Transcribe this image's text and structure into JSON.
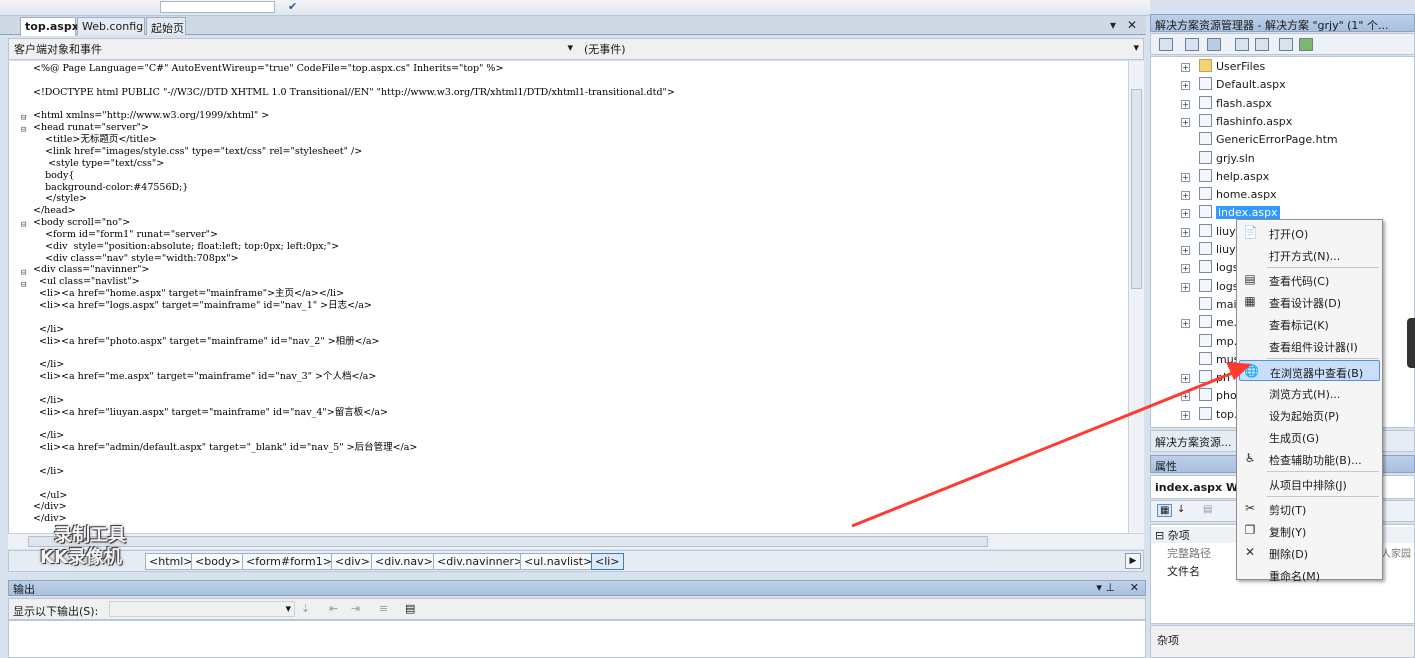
{
  "tabs": [
    {
      "label": "top.aspx",
      "active": true
    },
    {
      "label": "Web.config",
      "active": false
    },
    {
      "label": "起始页",
      "active": false
    }
  ],
  "tab_controls": {
    "dropdown": "▾",
    "close": "✕"
  },
  "object_bar": {
    "object_combo": "客户端对象和事件",
    "event_combo": "(无事件)"
  },
  "code_lines": [
    "<%@ Page Language=\"C#\" AutoEventWireup=\"true\" CodeFile=\"top.aspx.cs\" Inherits=\"top\" %>",
    "",
    "<!DOCTYPE html PUBLIC \"-//W3C//DTD XHTML 1.0 Transitional//EN\" \"http://www.w3.org/TR/xhtml1/DTD/xhtml1-transitional.dtd\">",
    "",
    "<html xmlns=\"http://www.w3.org/1999/xhtml\" >",
    "<head runat=\"server\">",
    "    <title>无标题页</title>",
    "    <link href=\"images/style.css\" type=\"text/css\" rel=\"stylesheet\" />",
    "     <style type=\"text/css\">",
    "    body{",
    "    background-color:#47556D;}",
    "    </style>",
    "</head>",
    "<body scroll=\"no\">",
    "    <form id=\"form1\" runat=\"server\">",
    "    <div  style=\"position:absolute; float:left; top:0px; left:0px;\">",
    "    <div class=\"nav\" style=\"width:708px\">",
    "<div class=\"navinner\">",
    "  <ul class=\"navlist\">",
    "  <li><a href=\"home.aspx\" target=\"mainframe\">主页</a></li>",
    "  <li><a href=\"logs.aspx\" target=\"mainframe\" id=\"nav_1\" >日志</a>",
    "",
    "  </li>",
    "  <li><a href=\"photo.aspx\" target=\"mainframe\" id=\"nav_2\" >相册</a>",
    "",
    "  </li>",
    "  <li><a href=\"me.aspx\" target=\"mainframe\" id=\"nav_3\" >个人档</a>",
    "",
    "  </li>",
    "  <li><a href=\"liuyan.aspx\" target=\"mainframe\" id=\"nav_4\">留言板</a>",
    "",
    "  </li>",
    "  <li><a href=\"admin/default.aspx\" target=\"_blank\" id=\"nav_5\" >后台管理</a>",
    "",
    "  </li>",
    "",
    "  </ul>",
    "</div>",
    "</div>"
  ],
  "breadcrumbs": [
    "<html>",
    "<body>",
    "<form#form1>",
    "<div>",
    "<div.nav>",
    "<div.navinner>",
    "<ul.navlist>",
    "<li>"
  ],
  "watermark": {
    "line1": "录制工具",
    "line2": "KK录像机"
  },
  "output_panel": {
    "title": "输出",
    "show_output_from_label": "显示以下输出(S):"
  },
  "solution_explorer": {
    "title": "解决方案资源管理器 - 解决方案 \"grjy\" (1\" 个...",
    "items": [
      {
        "label": "UserFiles",
        "type": "folder",
        "expandable": true
      },
      {
        "label": "Default.aspx",
        "type": "page",
        "expandable": true
      },
      {
        "label": "flash.aspx",
        "type": "page",
        "expandable": true
      },
      {
        "label": "flashinfo.aspx",
        "type": "page",
        "expandable": true
      },
      {
        "label": "GenericErrorPage.htm",
        "type": "page",
        "expandable": false
      },
      {
        "label": "grjy.sln",
        "type": "file",
        "expandable": false
      },
      {
        "label": "help.aspx",
        "type": "page",
        "expandable": true
      },
      {
        "label": "home.aspx",
        "type": "page",
        "expandable": true
      },
      {
        "label": "index.aspx",
        "type": "page",
        "expandable": true,
        "selected": true
      },
      {
        "label": "liuya",
        "type": "page",
        "expandable": true
      },
      {
        "label": "liuya",
        "type": "page",
        "expandable": true
      },
      {
        "label": "logs.",
        "type": "page",
        "expandable": true
      },
      {
        "label": "logs.",
        "type": "page",
        "expandable": true
      },
      {
        "label": "mai",
        "type": "file",
        "expandable": false
      },
      {
        "label": "me.",
        "type": "page",
        "expandable": true
      },
      {
        "label": "mp.",
        "type": "file",
        "expandable": false
      },
      {
        "label": "mus",
        "type": "file",
        "expandable": false
      },
      {
        "label": "ph",
        "type": "page",
        "expandable": true
      },
      {
        "label": "pho",
        "type": "page",
        "expandable": true
      },
      {
        "label": "top.",
        "type": "page",
        "expandable": true
      }
    ],
    "footer_tab": "解决方案资源..."
  },
  "properties": {
    "title": "属性",
    "object": "index.aspx We",
    "category": "杂项",
    "rows": [
      {
        "name": "完整路径",
        "value": "人家园"
      },
      {
        "name": "文件名",
        "value": ""
      }
    ],
    "description": "杂项"
  },
  "context_menu": {
    "items": [
      {
        "label": "打开(O)",
        "icon": "open-icon",
        "glyph": "📄"
      },
      {
        "label": "打开方式(N)...",
        "icon": "",
        "glyph": ""
      },
      {
        "sep": true
      },
      {
        "label": "查看代码(C)",
        "icon": "view-code-icon",
        "glyph": "▤"
      },
      {
        "label": "查看设计器(D)",
        "icon": "view-designer-icon",
        "glyph": "▦"
      },
      {
        "label": "查看标记(K)",
        "icon": "",
        "glyph": ""
      },
      {
        "label": "查看组件设计器(I)",
        "icon": "",
        "glyph": ""
      },
      {
        "sep": true
      },
      {
        "label": "在浏览器中查看(B)",
        "icon": "browser-view-icon",
        "glyph": "🌐",
        "highlighted": true
      },
      {
        "label": "浏览方式(H)...",
        "icon": "",
        "glyph": ""
      },
      {
        "label": "设为起始页(P)",
        "icon": "",
        "glyph": ""
      },
      {
        "label": "生成页(G)",
        "icon": "",
        "glyph": ""
      },
      {
        "label": "检查辅助功能(B)...",
        "icon": "accessibility-icon",
        "glyph": "♿"
      },
      {
        "sep": true
      },
      {
        "label": "从项目中排除(J)",
        "icon": "",
        "glyph": ""
      },
      {
        "sep": true
      },
      {
        "label": "剪切(T)",
        "icon": "scissors-icon",
        "glyph": "✂"
      },
      {
        "label": "复制(Y)",
        "icon": "copy-icon",
        "glyph": "❐"
      },
      {
        "label": "删除(D)",
        "icon": "delete-icon",
        "glyph": "✕"
      },
      {
        "label": "重命名(M)",
        "icon": "",
        "glyph": ""
      }
    ]
  },
  "colors": {
    "accent_selection": "#3399ff",
    "annotation_arrow": "#ff3b30"
  }
}
